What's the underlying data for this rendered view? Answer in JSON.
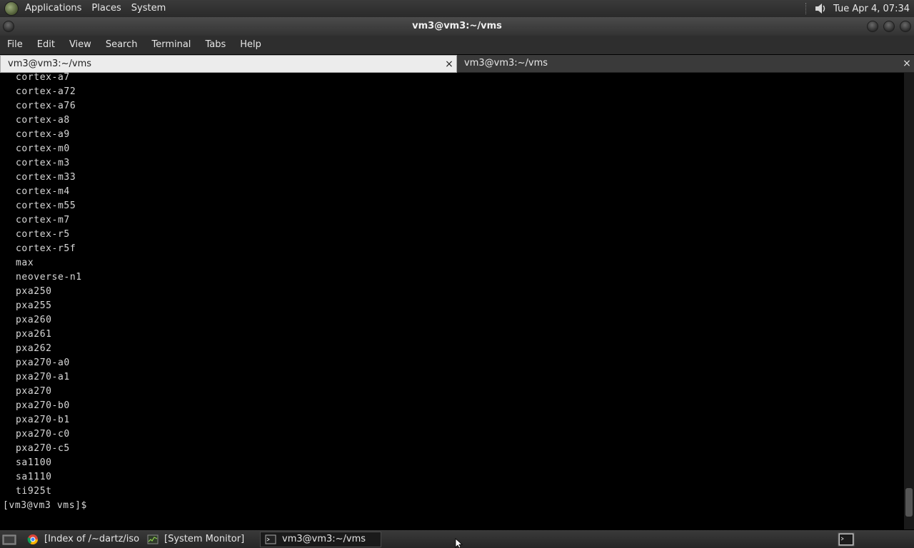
{
  "panel": {
    "menus": [
      "Applications",
      "Places",
      "System"
    ],
    "clock": "Tue Apr  4, 07:34"
  },
  "window": {
    "title": "vm3@vm3:~/vms"
  },
  "menubar": [
    "File",
    "Edit",
    "View",
    "Search",
    "Terminal",
    "Tabs",
    "Help"
  ],
  "tabs": [
    {
      "label": "vm3@vm3:~/vms",
      "close": "×"
    },
    {
      "label": "vm3@vm3:~/vms",
      "close": "×"
    }
  ],
  "terminal": {
    "lines": [
      "cortex-a7",
      "cortex-a72",
      "cortex-a76",
      "cortex-a8",
      "cortex-a9",
      "cortex-m0",
      "cortex-m3",
      "cortex-m33",
      "cortex-m4",
      "cortex-m55",
      "cortex-m7",
      "cortex-r5",
      "cortex-r5f",
      "max",
      "neoverse-n1",
      "pxa250",
      "pxa255",
      "pxa260",
      "pxa261",
      "pxa262",
      "pxa270-a0",
      "pxa270-a1",
      "pxa270",
      "pxa270-b0",
      "pxa270-b1",
      "pxa270-c0",
      "pxa270-c5",
      "sa1100",
      "sa1110",
      "ti925t"
    ],
    "prompt": "[vm3@vm3 vms]$ "
  },
  "taskbar": {
    "tasks": [
      {
        "label": "[Index of /~dartz/iso...",
        "icon": "chrome-icon"
      },
      {
        "label": "[System Monitor]",
        "icon": "system-monitor-icon"
      },
      {
        "label": "vm3@vm3:~/vms",
        "icon": "terminal-icon"
      }
    ]
  }
}
